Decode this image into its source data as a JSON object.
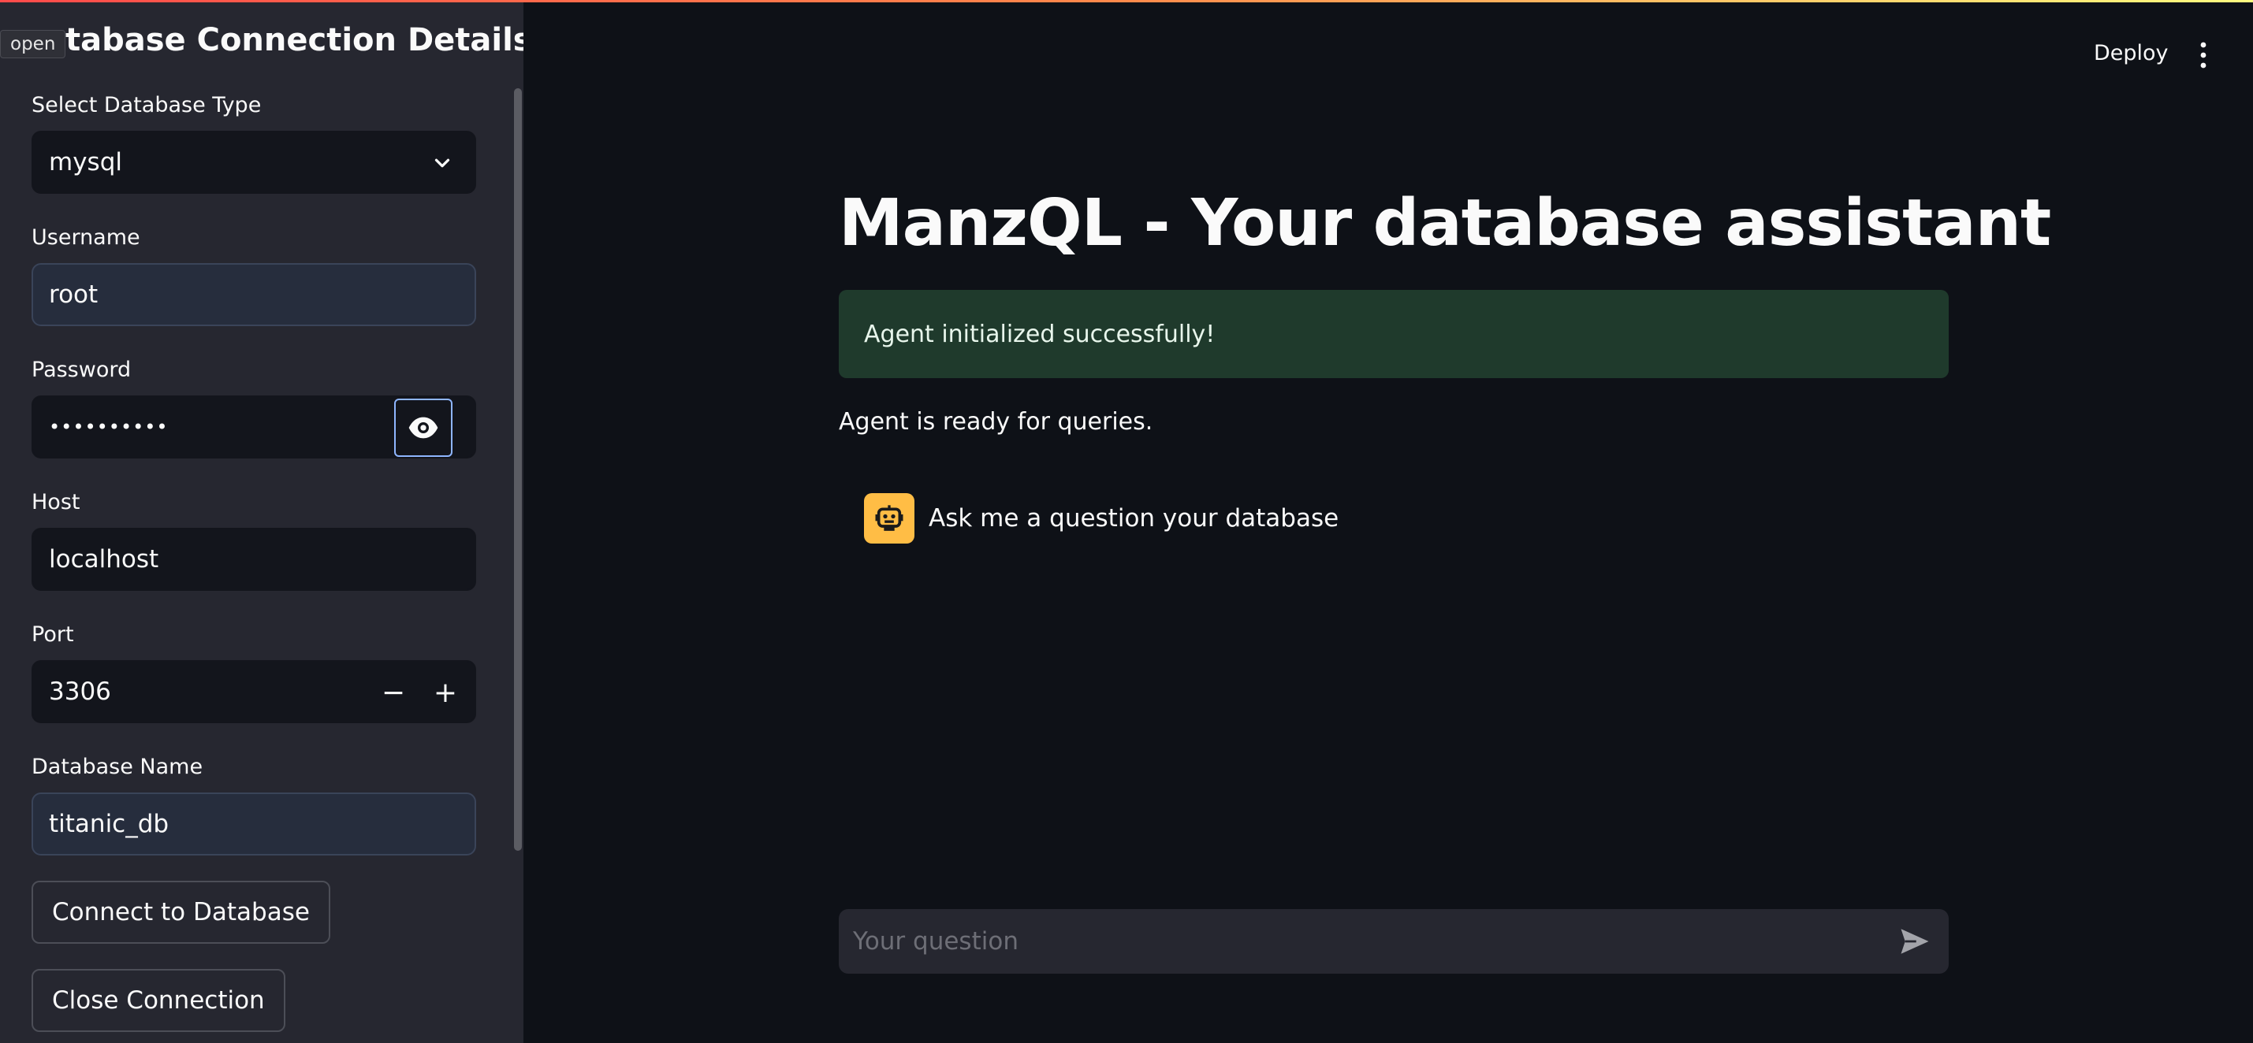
{
  "sidebar": {
    "open_tag": "open",
    "title": "atabase Connection Details",
    "db_type": {
      "label": "Select Database Type",
      "value": "mysql"
    },
    "username": {
      "label": "Username",
      "value": "root"
    },
    "password": {
      "label": "Password",
      "value": "••••••••••"
    },
    "host": {
      "label": "Host",
      "value": "localhost"
    },
    "port": {
      "label": "Port",
      "value": "3306",
      "minus": "−",
      "plus": "+"
    },
    "database": {
      "label": "Database Name",
      "value": "titanic_db"
    },
    "connect_label": "Connect to Database",
    "close_label": "Close Connection"
  },
  "header": {
    "deploy_label": "Deploy"
  },
  "main": {
    "title": "ManzQL - Your database assistant",
    "success_message": "Agent initialized successfully!",
    "status_text": "Agent is ready for queries.",
    "chat_message": "Ask me a question your database",
    "chat_input_placeholder": "Your question"
  },
  "colors": {
    "background": "#0e1117",
    "sidebar": "#262730",
    "success_bg": "#1f3a2c",
    "bot_avatar": "#ffbd45",
    "focus_outline": "#8fb6ff"
  },
  "icons": [
    "chevron-down-icon",
    "eye-icon",
    "minus-icon",
    "plus-icon",
    "kebab-menu-icon",
    "robot-icon",
    "send-icon"
  ]
}
